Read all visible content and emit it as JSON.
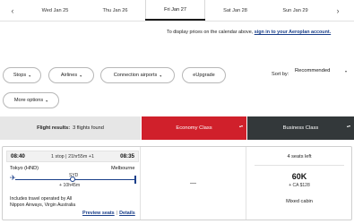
{
  "date_strip": {
    "prev_arrow": "‹",
    "next_arrow": "›",
    "dates": [
      "Wed Jan 25",
      "Thu Jan 26",
      "Fri Jan 27",
      "Sat Jan 28",
      "Sun Jan 29"
    ],
    "active_date": "Fri Jan 27"
  },
  "prompt": {
    "text": "To display prices on the calendar above, ",
    "link": "sign in to your Aeroplan account."
  },
  "filters": {
    "stops": "Stops",
    "airlines": "Airlines",
    "connection_airports": "Connection airports",
    "eupgrade": "eUpgrade",
    "more_options": "More options",
    "chevron": "▾"
  },
  "sort": {
    "label": "Sort by:",
    "value": "Recommended",
    "chevron": "▾"
  },
  "results_header": {
    "title_bold": "Flight results:",
    "title_count": "3 flights found",
    "economy": "Economy Class",
    "business": "Business Class",
    "sorter": "▴▾"
  },
  "flight": {
    "depart_time": "08:40",
    "stops_duration": "1 stop | 21hr55m +1",
    "arrive_time": "08:35",
    "origin": "Tokyo (HND)",
    "destination": "Melbourne",
    "stop_airport": "SYD",
    "layover": "+ 10h45m",
    "plane_icon": "✈",
    "operators": "Includes travel operated by All Nippon Airways, Virgin Australia",
    "preview_seats": "Preview seats",
    "details": "Details",
    "link_sep": "|",
    "economy_value": "—",
    "business": {
      "seats_left": "4 seats left",
      "points": "60K",
      "cash": "+ CA $128",
      "cabin": "Mixed cabin"
    }
  }
}
